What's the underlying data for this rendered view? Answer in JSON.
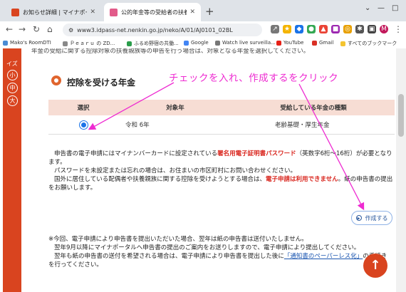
{
  "browser": {
    "tabs": [
      {
        "title": "お知らせ詳細 | マイナポータル",
        "favicon_color": "#d9441f"
      },
      {
        "title": "公的年金等の受給者の扶養親族等申告書",
        "favicon_color": "#e25b8a"
      }
    ],
    "new_tab_label": "+",
    "url": "www3.idpass-net.nenkin.go.jp/neko/A/01/AJ0101_02BL",
    "profile_initial": "M"
  },
  "bookmarks": [
    {
      "label": "Mako's RoomDTI",
      "color": "#4a8bd4"
    },
    {
      "label": "Ｐｅａｒｕ の ZD...",
      "color": "#888888"
    },
    {
      "label": "ふるめ野宿の共働...",
      "color": "#2a9d4b"
    },
    {
      "label": "Google",
      "color": "#4285f4"
    },
    {
      "label": "Watch live surveilla...",
      "color": "#777777"
    },
    {
      "label": "YouTube",
      "color": "#e62117"
    },
    {
      "label": "Gmail",
      "color": "#d93025"
    },
    {
      "label": "すべてのブックマーク",
      "color": "#f4c430"
    }
  ],
  "sidebar": {
    "partial_label": "イズ",
    "size_buttons": [
      "小",
      "中",
      "大"
    ]
  },
  "page": {
    "top_partial_text": "年金の受給に関する控除対象の扶養親族等の申告を行う場合は、対象となる年金を選択してください。",
    "section_title": "控除を受ける年金",
    "table": {
      "headers": [
        "選択",
        "対象年",
        "受給している年金の種類"
      ],
      "rows": [
        {
          "year": "令和 6年",
          "type": "老齢基礎・厚生年金"
        }
      ]
    },
    "paragraph1_before": "申告書の電子申請にはマイナンバーカードに設定されている",
    "paragraph1_red": "署名用電子証明書パスワード",
    "paragraph1_after": "（英数字6桁～16桁）が必要となります。",
    "paragraph2": "パスワードを未設定または忘れの場合は、お住まいの市区町村にお問い合わせください。",
    "paragraph3_before": "国外に居住している配偶者や扶養親族に関する控除を受けようとする場合は、",
    "paragraph3_red": "電子申請は利用できません",
    "paragraph3_after": "。紙の申告書の提出をお願いします。",
    "create_button": "作成する",
    "notes": [
      "※今回、電子申請により申告書を提出いただいた場合、翌年は紙の申告書は送付いたしません。",
      "翌年9月以降にマイナポータルへ申告書の提出のご案内をお送りしますので、電子申請により提出してください。",
      "翌年も紙の申告書の送付を希望される場合は、電子申請により申告書を提出した後に"
    ],
    "notes_link": "「通知書のペーパーレス化」",
    "notes_tail": "の手続き",
    "notes_last": "を行ってください。"
  },
  "annotation": {
    "text": "チェックを入れ、作成するをクリック",
    "color": "#ee2bd1"
  }
}
